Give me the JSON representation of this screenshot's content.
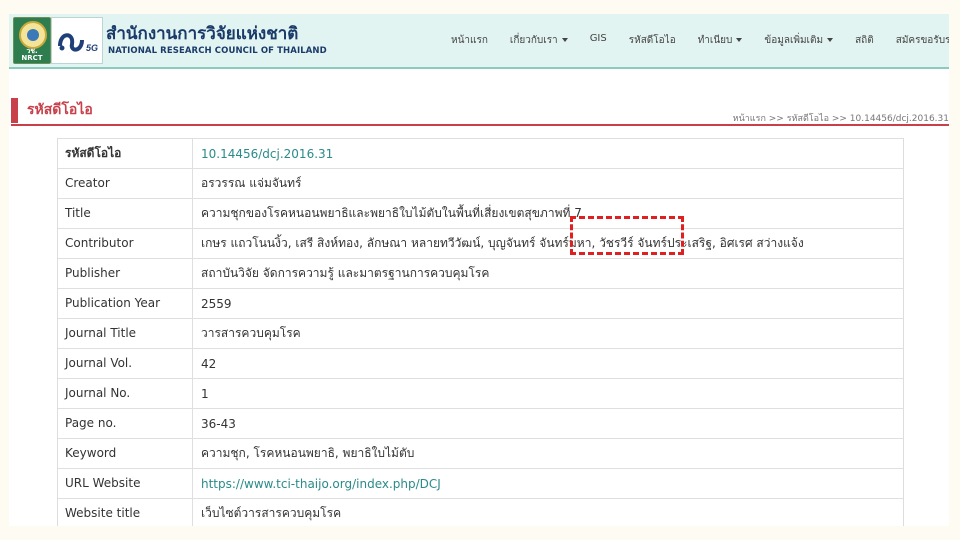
{
  "header": {
    "seal_text": "วช.\nNRCT",
    "org_name_th": "สำนักงานการวิจัยแห่งชาติ",
    "org_name_en": "NATIONAL RESEARCH COUNCIL OF THAILAND",
    "logo_5g_label": "วช",
    "logo_5g_suffix": "5G"
  },
  "nav": [
    {
      "label": "หน้าแรก",
      "dropdown": false
    },
    {
      "label": "เกี่ยวกับเรา",
      "dropdown": true
    },
    {
      "label": "GIS",
      "dropdown": false
    },
    {
      "label": "รหัสดีโอไอ",
      "dropdown": false
    },
    {
      "label": "ทำเนียบ",
      "dropdown": true
    },
    {
      "label": "ข้อมูลเพิ่มเติม",
      "dropdown": true
    },
    {
      "label": "สถิติ",
      "dropdown": false
    },
    {
      "label": "สมัครขอรับรหัสดีโอไอ",
      "dropdown": true
    }
  ],
  "page": {
    "title": "รหัสดีโอไอ",
    "breadcrumb": "หน้าแรก >> รหัสดีโอไอ >> 10.14456/dcj.2016.31"
  },
  "table": [
    {
      "label": "รหัสดีโอไอ",
      "value": "10.14456/dcj.2016.31",
      "link": true
    },
    {
      "label": "Creator",
      "value": "อรวรรณ แจ่มจันทร์",
      "link": false
    },
    {
      "label": "Title",
      "value": "ความชุกของโรคหนอนพยาธิและพยาธิใบไม้ตับในพื้นที่เสี่ยงเขตสุขภาพที่ 7",
      "link": false
    },
    {
      "label": "Contributor",
      "value": "เกษร แถวโนนงิ้ว, เสรี สิงห์ทอง, ลักษณา หลายทวีวัฒน์, บุญจันทร์ จันทร์มหา, วัชรวีร์ จันทร์ประเสริฐ, อิศเรศ สว่างแจ้ง",
      "link": false
    },
    {
      "label": "Publisher",
      "value": "สถาบันวิจัย จัดการความรู้ และมาตรฐานการควบคุมโรค",
      "link": false
    },
    {
      "label": "Publication Year",
      "value": "2559",
      "link": false
    },
    {
      "label": "Journal Title",
      "value": "วารสารควบคุมโรค",
      "link": false
    },
    {
      "label": "Journal Vol.",
      "value": "42",
      "link": false
    },
    {
      "label": "Journal No.",
      "value": "1",
      "link": false
    },
    {
      "label": "Page no.",
      "value": "36-43",
      "link": false
    },
    {
      "label": "Keyword",
      "value": "ความชุก, โรคหนอนพยาธิ, พยาธิใบไม้ตับ",
      "link": false
    },
    {
      "label": "URL Website",
      "value": "https://www.tci-thaijo.org/index.php/DCJ",
      "link": true
    },
    {
      "label": "Website title",
      "value": "เว็บไซต์วารสารควบคุมโรค",
      "link": false
    },
    {
      "label": "",
      "value": "",
      "link": false
    }
  ],
  "colors": {
    "accent": "#c7404a",
    "header_bg": "#e2f4f1",
    "link": "#2b8a8a",
    "highlight": "#e02020"
  }
}
